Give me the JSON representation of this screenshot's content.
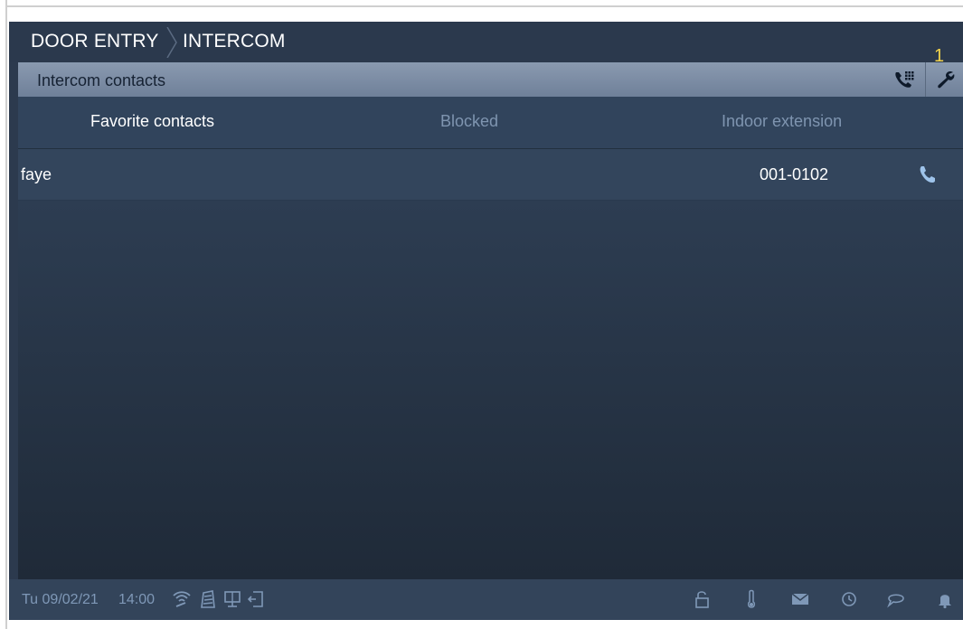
{
  "breadcrumb": [
    "DOOR ENTRY",
    "INTERCOM"
  ],
  "titlebar": {
    "title": "Intercom contacts",
    "badge": "1"
  },
  "tabs": [
    "Favorite contacts",
    "Blocked",
    "Indoor extension"
  ],
  "contacts": [
    {
      "name": "faye",
      "number": "001-0102"
    }
  ],
  "statusbar": {
    "date": "Tu 09/02/21",
    "time": "14:00"
  },
  "colors": {
    "accent_badge": "#f4d44a",
    "active_tab": "#ffffff",
    "inactive_tab": "#7f95b0"
  },
  "icons": {
    "titlebar": [
      "phone-keypad-icon",
      "wrench-icon"
    ],
    "row": "phone-icon",
    "status_left": [
      "wifi-icon",
      "building-icon",
      "screen-icon",
      "exit-icon"
    ],
    "status_right": [
      "lock-icon",
      "thermometer-icon",
      "mail-icon",
      "history-icon",
      "chat-icon",
      "bell-icon"
    ]
  }
}
